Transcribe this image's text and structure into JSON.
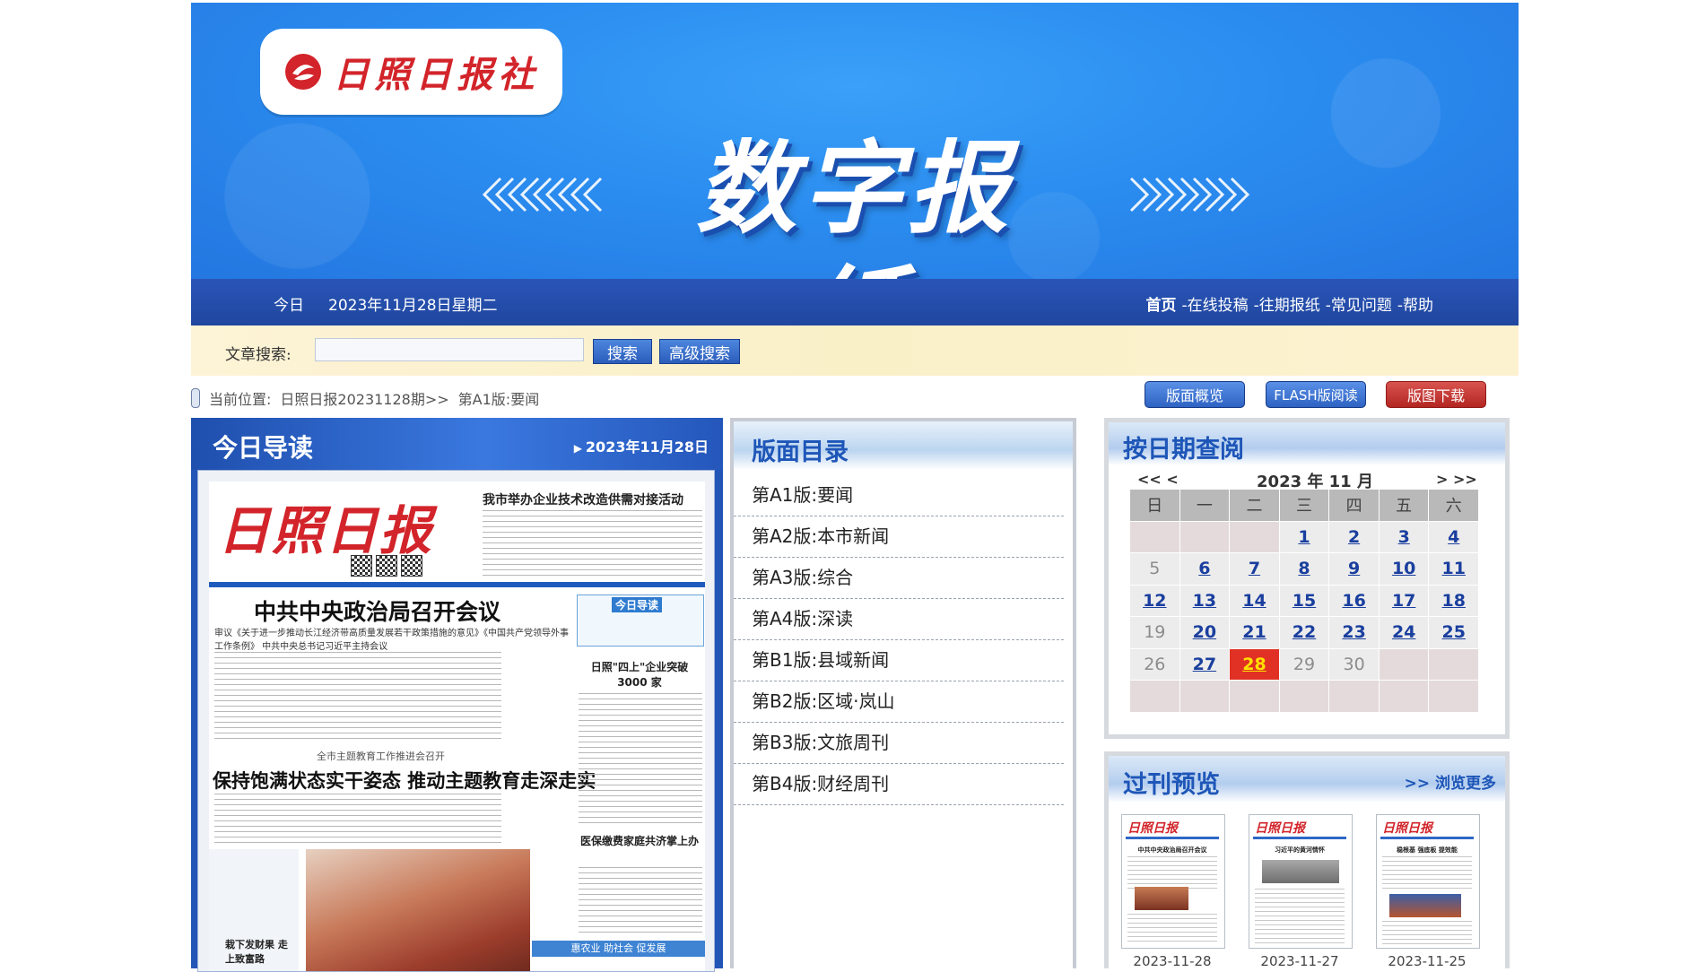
{
  "banner": {
    "logo_text": "日照日报社",
    "title": "数字报纸"
  },
  "nav": {
    "today_label": "今日",
    "date": "2023年11月28日星期二",
    "links": [
      "首页",
      "-在线投稿",
      "-往期报纸",
      "-常见问题",
      "-帮助"
    ]
  },
  "search": {
    "label": "文章搜索:",
    "value": "",
    "search_button": "搜索",
    "advanced_button": "高级搜索"
  },
  "breadcrumb": {
    "prefix": "当前位置:",
    "issue": "日照日报20231128期>>",
    "page": "第A1版:要闻"
  },
  "toolbar": {
    "overview": "版面概览",
    "flash": "FLASH版阅读",
    "download": "版图下载"
  },
  "today": {
    "title": "今日导读",
    "date": "2023年11月28日",
    "paper": {
      "masthead": "日照日报",
      "top_story": "我市举办企业技术改造供需对接活动",
      "headline1": "中共中央政治局召开会议",
      "headline1_sub": "审议《关于进一步推动长江经济带高质量发展若干政策措施的意见》《中国共产党领导外事工作条例》 中共中央总书记习近平主持会议",
      "headline2_pre": "全市主题教育工作推进会召开",
      "headline2": "保持饱满状态实干姿态 推动主题教育走深走实",
      "guide_tag": "今日导读",
      "side1": "日照\"四上\"企业突破 3000 家",
      "side2": "医保缴费家庭共济掌上办",
      "photo_caption": "栽下发财果 走上致富路",
      "strip": "惠农业 助社会 促发展"
    }
  },
  "directory": {
    "title": "版面目录",
    "items": [
      "第A1版:要闻",
      "第A2版:本市新闻",
      "第A3版:综合",
      "第A4版:深读",
      "第B1版:县域新闻",
      "第B2版:区域·岚山",
      "第B3版:文旅周刊",
      "第B4版:财经周刊"
    ]
  },
  "calendar": {
    "title": "按日期查阅",
    "prev": "<< <",
    "next": "> >>",
    "month_label": "2023 年 11 月",
    "weekdays": [
      "日",
      "一",
      "二",
      "三",
      "四",
      "五",
      "六"
    ],
    "weeks": [
      [
        {
          "t": "",
          "k": "blank"
        },
        {
          "t": "",
          "k": "blank"
        },
        {
          "t": "",
          "k": "blank"
        },
        {
          "t": "1",
          "k": "link"
        },
        {
          "t": "2",
          "k": "link"
        },
        {
          "t": "3",
          "k": "link"
        },
        {
          "t": "4",
          "k": "link"
        }
      ],
      [
        {
          "t": "5",
          "k": "plain"
        },
        {
          "t": "6",
          "k": "link"
        },
        {
          "t": "7",
          "k": "link"
        },
        {
          "t": "8",
          "k": "link"
        },
        {
          "t": "9",
          "k": "link"
        },
        {
          "t": "10",
          "k": "link"
        },
        {
          "t": "11",
          "k": "link"
        }
      ],
      [
        {
          "t": "12",
          "k": "link"
        },
        {
          "t": "13",
          "k": "link"
        },
        {
          "t": "14",
          "k": "link"
        },
        {
          "t": "15",
          "k": "link"
        },
        {
          "t": "16",
          "k": "link"
        },
        {
          "t": "17",
          "k": "link"
        },
        {
          "t": "18",
          "k": "link"
        }
      ],
      [
        {
          "t": "19",
          "k": "plain"
        },
        {
          "t": "20",
          "k": "link"
        },
        {
          "t": "21",
          "k": "link"
        },
        {
          "t": "22",
          "k": "link"
        },
        {
          "t": "23",
          "k": "link"
        },
        {
          "t": "24",
          "k": "link"
        },
        {
          "t": "25",
          "k": "link"
        }
      ],
      [
        {
          "t": "26",
          "k": "plain"
        },
        {
          "t": "27",
          "k": "link"
        },
        {
          "t": "28",
          "k": "today"
        },
        {
          "t": "29",
          "k": "plain"
        },
        {
          "t": "30",
          "k": "plain"
        },
        {
          "t": "",
          "k": "blank"
        },
        {
          "t": "",
          "k": "blank"
        }
      ],
      [
        {
          "t": "",
          "k": "blank"
        },
        {
          "t": "",
          "k": "blank"
        },
        {
          "t": "",
          "k": "blank"
        },
        {
          "t": "",
          "k": "blank"
        },
        {
          "t": "",
          "k": "blank"
        },
        {
          "t": "",
          "k": "blank"
        },
        {
          "t": "",
          "k": "blank"
        }
      ]
    ]
  },
  "past": {
    "title": "过刊预览",
    "more": ">> 浏览更多",
    "issues": [
      {
        "date": "2023-11-28",
        "masthead": "日照日报",
        "headline": "中共中央政治局召开会议"
      },
      {
        "date": "2023-11-27",
        "masthead": "日照日报",
        "headline": "习近平的黄河情怀"
      },
      {
        "date": "2023-11-25",
        "masthead": "日照日报",
        "headline": "稳根基 强底板 提效能"
      }
    ]
  },
  "colors": {
    "banner_blue": "#2b8df0",
    "nav_blue": "#2a55b8",
    "title_blue": "#1e56b8",
    "brand_red": "#d2242a",
    "today_red": "#e03124"
  }
}
